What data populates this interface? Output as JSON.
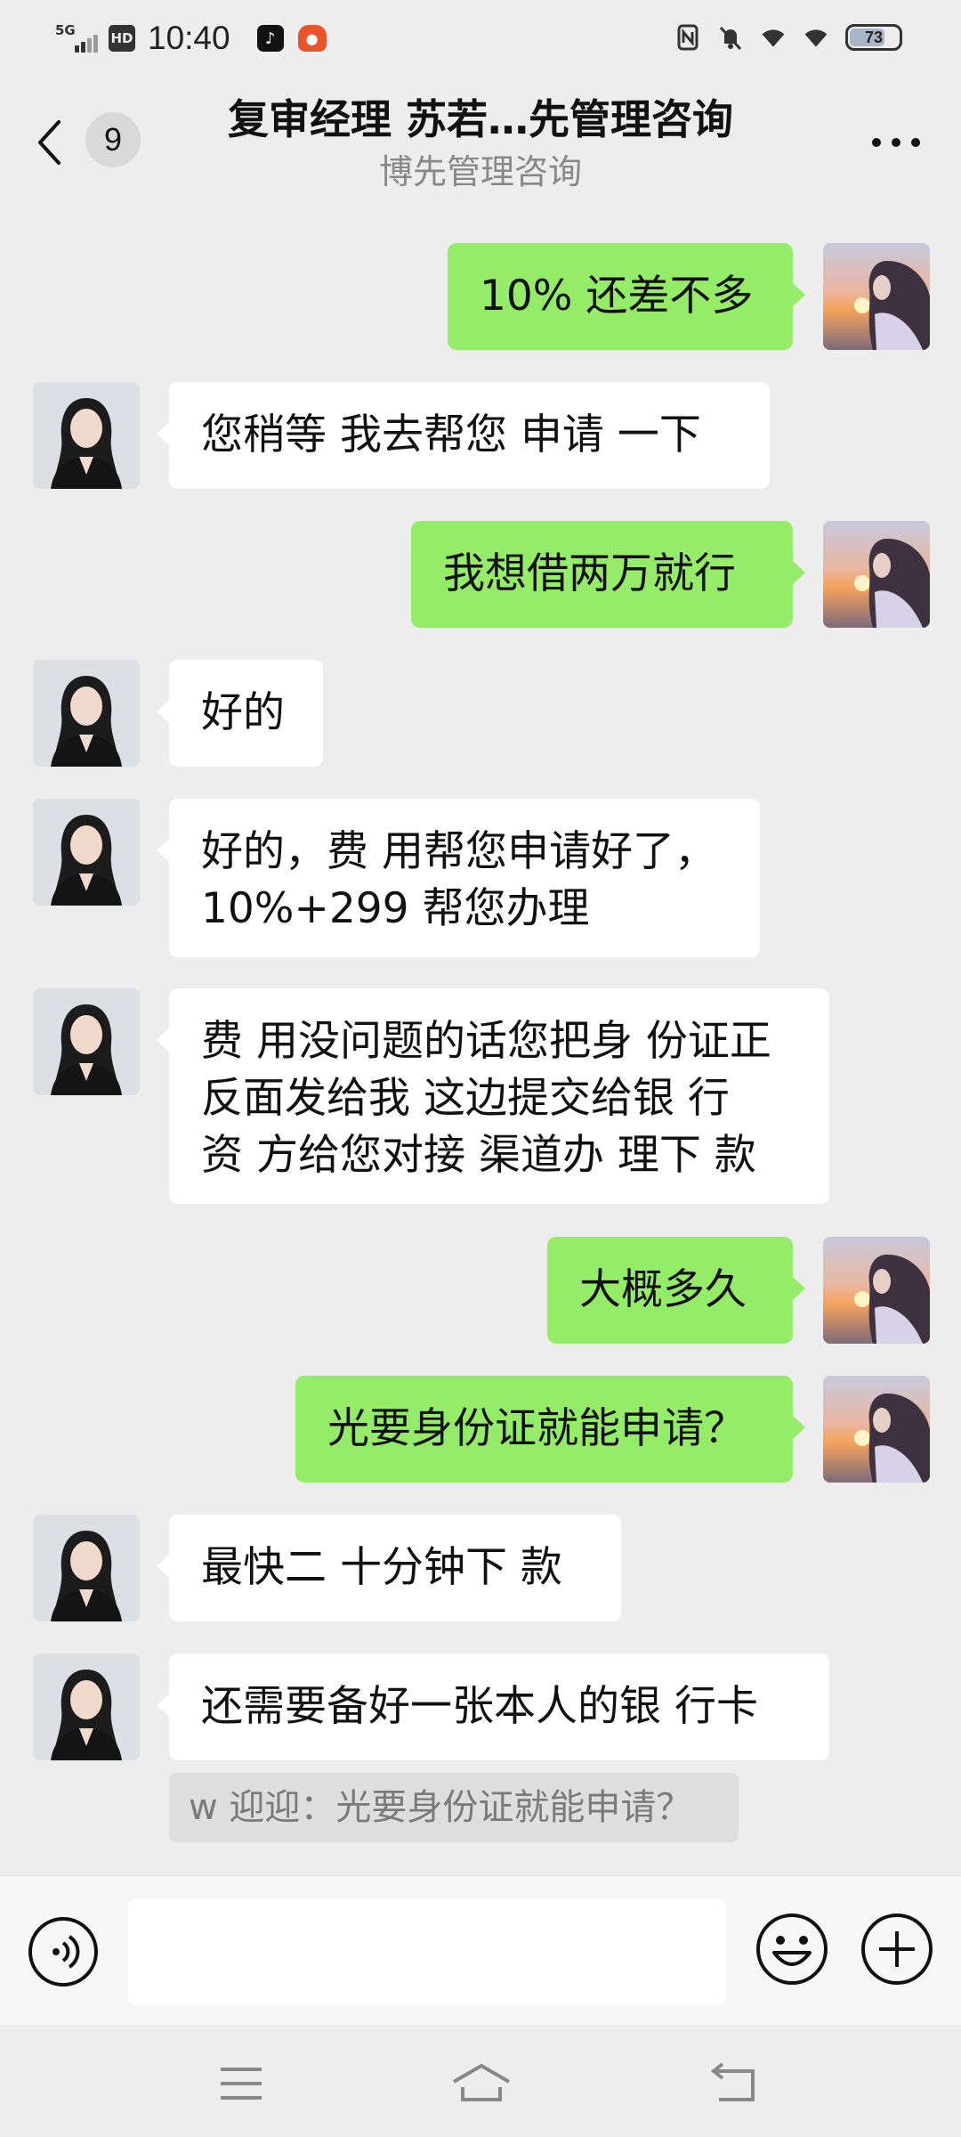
{
  "status_bar": {
    "network": "5G",
    "hd": "HD",
    "time": "10:40",
    "battery": "73",
    "battery_level": 0.73,
    "icons": [
      "tiktok-icon",
      "app-icon",
      "nfc-icon",
      "mute-icon",
      "wifi-icon",
      "wifi-icon"
    ]
  },
  "header": {
    "unread_count": "9",
    "title": "复审经理 苏若…先管理咨询",
    "subtitle": "博先管理咨询"
  },
  "messages": [
    {
      "side": "right",
      "text": "10% 还差不多"
    },
    {
      "side": "left",
      "text": "您稍等 我去帮您 申请 一下"
    },
    {
      "side": "right",
      "text": "我想借两万就行"
    },
    {
      "side": "left",
      "text": "好的"
    },
    {
      "side": "left",
      "lines": [
        "好的，费 用帮您申请好了，",
        "10%+299 帮您办理"
      ]
    },
    {
      "side": "left",
      "lines": [
        "费 用没问题的话您把身 份证正",
        "反面发给我   这边提交给银 行",
        "资 方给您对接 渠道办 理下 款"
      ]
    },
    {
      "side": "right",
      "text": "大概多久"
    },
    {
      "side": "right",
      "text": "光要身份证就能申请？"
    },
    {
      "side": "left",
      "text": "最快二 十分钟下 款"
    },
    {
      "side": "left",
      "text": "还需要备好一张本人的银 行卡"
    }
  ],
  "quote": "w 迎迎：光要身份证就能申请？",
  "input": {
    "value": "",
    "placeholder": ""
  },
  "colors": {
    "background": "#ededed",
    "self_bubble": "#95ec69",
    "other_bubble": "#ffffff"
  }
}
